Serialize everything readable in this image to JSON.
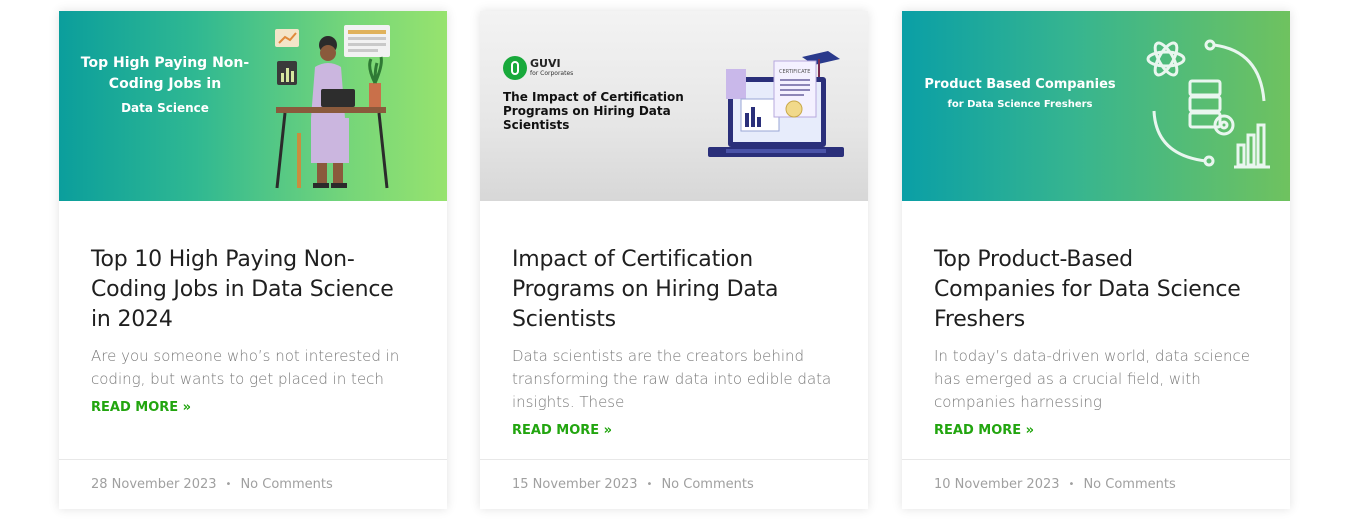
{
  "posts": [
    {
      "thumb": {
        "title": "Top High Paying Non-Coding Jobs in",
        "subtitle": "Data Science"
      },
      "title": "Top 10 High Paying Non-Coding Jobs in Data Science in 2024",
      "excerpt": "Are you someone who’s not interested in coding, but wants to get placed in tech",
      "read_more": "READ MORE »",
      "date": "28 November 2023",
      "separator": "•",
      "comments": "No Comments"
    },
    {
      "thumb": {
        "brand": "GUVI",
        "brand_sub": "for Corporates",
        "title": "The Impact of Certification Programs on Hiring Data Scientists",
        "certificate_label": "CERTIFICATE"
      },
      "title": "Impact of Certification Programs on Hiring Data Scientists",
      "excerpt": "Data scientists are the creators behind transforming the raw data into edible data insights. These",
      "read_more": "READ MORE »",
      "date": "15 November 2023",
      "separator": "•",
      "comments": "No Comments"
    },
    {
      "thumb": {
        "title": "Product Based Companies",
        "subtitle": "for Data Science Freshers"
      },
      "title": "Top Product-Based Companies for Data Science Freshers",
      "excerpt": "In today’s data-driven world, data science has emerged as a crucial field, with companies harnessing",
      "read_more": "READ MORE »",
      "date": "10 November 2023",
      "separator": "•",
      "comments": "No Comments"
    }
  ],
  "colors": {
    "accent_green": "#22a50f",
    "title": "#1f1f1f",
    "excerpt": "#7a7a7a",
    "meta": "#a0a0a0"
  }
}
